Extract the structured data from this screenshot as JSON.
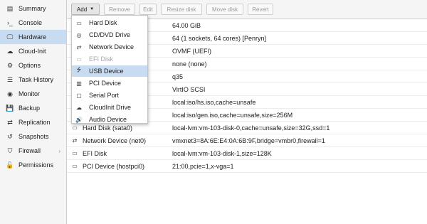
{
  "sidebar": {
    "items": [
      {
        "label": "Summary",
        "icon": "summary-icon",
        "glyph": "▤"
      },
      {
        "label": "Console",
        "icon": "console-icon",
        "glyph": "›_"
      },
      {
        "label": "Hardware",
        "icon": "monitor-icon",
        "glyph": "🖵",
        "active": true
      },
      {
        "label": "Cloud-Init",
        "icon": "cloud-icon",
        "glyph": "☁"
      },
      {
        "label": "Options",
        "icon": "gear-icon",
        "glyph": "⚙"
      },
      {
        "label": "Task History",
        "icon": "list-icon",
        "glyph": "☰"
      },
      {
        "label": "Monitor",
        "icon": "eye-icon",
        "glyph": "◉"
      },
      {
        "label": "Backup",
        "icon": "floppy-icon",
        "glyph": "💾"
      },
      {
        "label": "Replication",
        "icon": "retweet-icon",
        "glyph": "⇄"
      },
      {
        "label": "Snapshots",
        "icon": "history-icon",
        "glyph": "↺"
      },
      {
        "label": "Firewall",
        "icon": "shield-icon",
        "glyph": "⛉",
        "chevron": "›"
      },
      {
        "label": "Permissions",
        "icon": "unlock-icon",
        "glyph": "🔓"
      }
    ]
  },
  "toolbar": {
    "add": "Add",
    "remove": "Remove",
    "edit": "Edit",
    "resize": "Resize disk",
    "move": "Move disk",
    "revert": "Revert"
  },
  "hardware_rows": [
    {
      "name": "",
      "value": "64.00 GiB",
      "glyph": "▭"
    },
    {
      "name": "",
      "value": "64 (1 sockets, 64 cores) [Penryn]",
      "glyph": "▦"
    },
    {
      "name": "",
      "value": "OVMF (UEFI)",
      "glyph": "▭"
    },
    {
      "name": "",
      "value": "none (none)",
      "glyph": "▭"
    },
    {
      "name": "",
      "value": "q35",
      "glyph": "▭"
    },
    {
      "name": "",
      "value": "VirtIO SCSI",
      "glyph": "▭"
    },
    {
      "name": "",
      "value": "local:iso/hs.iso,cache=unsafe",
      "glyph": "◎"
    },
    {
      "name": "",
      "value": "local:iso/gen.iso,cache=unsafe,size=256M",
      "glyph": "◎"
    },
    {
      "name": "Hard Disk (sata0)",
      "value": "local-lvm:vm-103-disk-0,cache=unsafe,size=32G,ssd=1",
      "glyph": "▭"
    },
    {
      "name": "Network Device (net0)",
      "value": "vmxnet3=8A:6E:E4:0A:6B:9F,bridge=vmbr0,firewall=1",
      "glyph": "⇄"
    },
    {
      "name": "EFI Disk",
      "value": "local-lvm:vm-103-disk-1,size=128K",
      "glyph": "▭"
    },
    {
      "name": "PCI Device (hostpci0)",
      "value": "21:00,pcie=1,x-vga=1",
      "glyph": "▭"
    }
  ],
  "add_menu": [
    {
      "label": "Hard Disk",
      "icon": "hard-disk-icon",
      "glyph": "▭"
    },
    {
      "label": "CD/DVD Drive",
      "icon": "cdrom-icon",
      "glyph": "◎"
    },
    {
      "label": "Network Device",
      "icon": "network-icon",
      "glyph": "⇄"
    },
    {
      "label": "EFI Disk",
      "icon": "efi-disk-icon",
      "glyph": "▭",
      "disabled": true
    },
    {
      "label": "USB Device",
      "icon": "usb-icon",
      "glyph": "⭍",
      "hover": true
    },
    {
      "label": "PCI Device",
      "icon": "pci-icon",
      "glyph": "▥"
    },
    {
      "label": "Serial Port",
      "icon": "serial-port-icon",
      "glyph": "▢"
    },
    {
      "label": "CloudInit Drive",
      "icon": "cloud-icon",
      "glyph": "☁"
    },
    {
      "label": "Audio Device",
      "icon": "volume-icon",
      "glyph": "🔊"
    }
  ],
  "colors": {
    "active_bg": "#c7dcf0",
    "sidebar_bg": "#f5f5f5"
  }
}
